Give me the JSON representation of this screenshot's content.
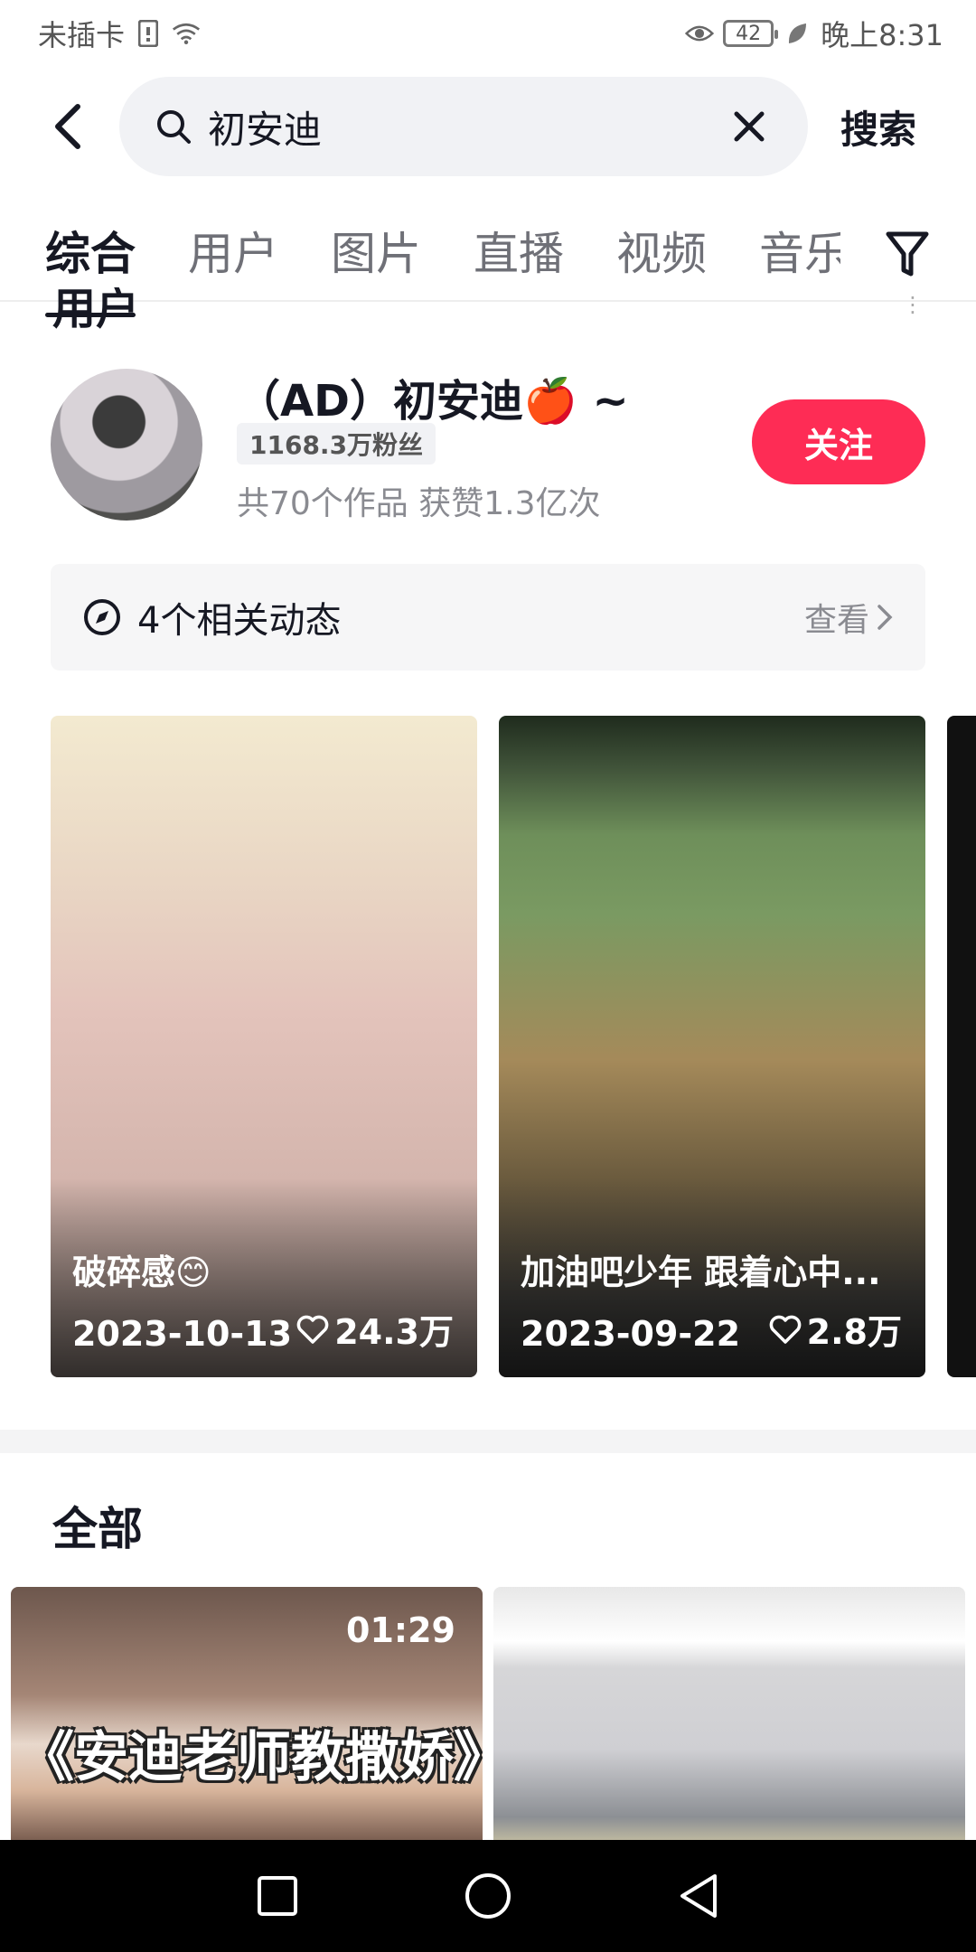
{
  "status_bar": {
    "left_text": "未插卡",
    "battery": "42",
    "time": "晚上8:31"
  },
  "search": {
    "query": "初安迪",
    "search_button": "搜索"
  },
  "tabs": [
    {
      "label": "综合",
      "active": true
    },
    {
      "label": "用户",
      "active": false
    },
    {
      "label": "图片",
      "active": false
    },
    {
      "label": "直播",
      "active": false
    },
    {
      "label": "视频",
      "active": false
    },
    {
      "label": "音乐",
      "active": false
    }
  ],
  "user_section": {
    "heading": "用户",
    "user": {
      "name": "（AD）初安迪🍎 ~",
      "fans": "1168.3万粉丝",
      "stats": "共70个作品 获赞1.3亿次",
      "follow_label": "关注"
    },
    "related": {
      "label": "4个相关动态",
      "view_label": "查看"
    }
  },
  "dynamic_cards": [
    {
      "title": "破碎感😊",
      "date": "2023-10-13",
      "likes": "24.3万"
    },
    {
      "title": "加油吧少年 跟着心中...",
      "date": "2023-09-22",
      "likes": "2.8万"
    }
  ],
  "all_section": {
    "heading": "全部",
    "videos": [
      {
        "duration": "01:29",
        "overlay_text": "《安迪老师教撒娇》"
      },
      {
        "duration": "",
        "overlay_text": ""
      }
    ]
  },
  "colors": {
    "accent": "#fe2c55",
    "text_primary": "#161823",
    "text_secondary": "#8a8b91"
  }
}
